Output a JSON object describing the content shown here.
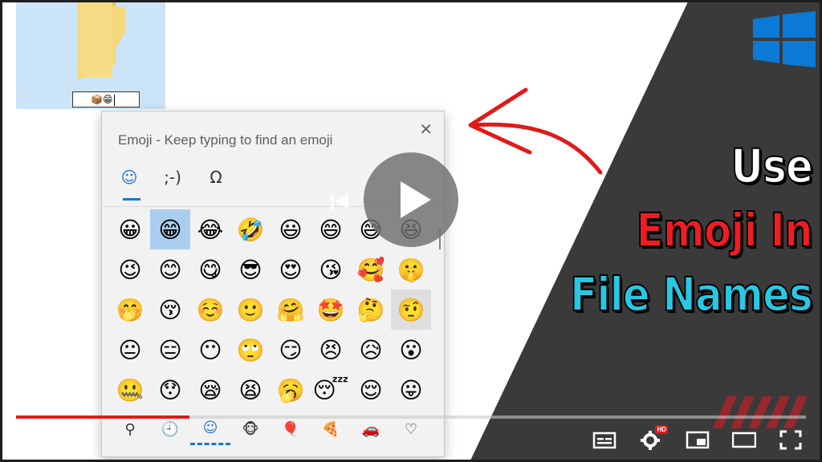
{
  "rename_box": {
    "value": "📦😁",
    "caret": true
  },
  "emoji_panel": {
    "title": "Emoji - Keep typing to find an emoji",
    "close_glyph": "✕",
    "tabs": [
      {
        "label": "☺",
        "name": "tab-emoji",
        "active": true
      },
      {
        "label": ";-)",
        "name": "tab-kaomoji",
        "active": false
      },
      {
        "label": "Ω",
        "name": "tab-symbols",
        "active": false
      }
    ],
    "grid": [
      [
        "😀",
        "😁",
        "😂",
        "🤣",
        "😃",
        "😄",
        "😅",
        "😆"
      ],
      [
        "😉",
        "😊",
        "😋",
        "😎",
        "😍",
        "😘",
        "🥰",
        "🤫"
      ],
      [
        "🤭",
        "😚",
        "☺️",
        "🙂",
        "🤗",
        "🤩",
        "🤔",
        "🤨"
      ],
      [
        "😐",
        "😑",
        "😶",
        "🙄",
        "😏",
        "😣",
        "😥",
        "😮"
      ],
      [
        "🤐",
        "😯",
        "😪",
        "😫",
        "🥱",
        "😴",
        "😌",
        "😛"
      ]
    ],
    "selected_cell": [
      0,
      1
    ],
    "hover_cell": [
      2,
      7
    ],
    "categories": [
      {
        "label": "⚲",
        "name": "search-icon"
      },
      {
        "label": "🕘",
        "name": "recent-icon"
      },
      {
        "label": "☺",
        "name": "smiley-category-icon",
        "active": true
      },
      {
        "label": "🐵",
        "name": "people-icon"
      },
      {
        "label": "🎈",
        "name": "celebration-icon"
      },
      {
        "label": "🍕",
        "name": "food-icon"
      },
      {
        "label": "🚗",
        "name": "travel-icon"
      },
      {
        "label": "♡",
        "name": "heart-icon"
      }
    ]
  },
  "thumbnail_title": {
    "line1": "Use",
    "line2": "Emoji In",
    "line3": "File Names"
  },
  "colors": {
    "dark_panel": "#3a3a3a",
    "title_white": "#ffffff",
    "title_red": "#ee1d23",
    "title_cyan": "#29c7e3",
    "arrow_red": "#e01a1a",
    "windows_blue": "#0a7ad6",
    "progress_red": "#e01a1a",
    "selection_blue": "#cce4f7"
  },
  "video": {
    "progress_fraction": 0.22,
    "hd_badge": "HD"
  }
}
